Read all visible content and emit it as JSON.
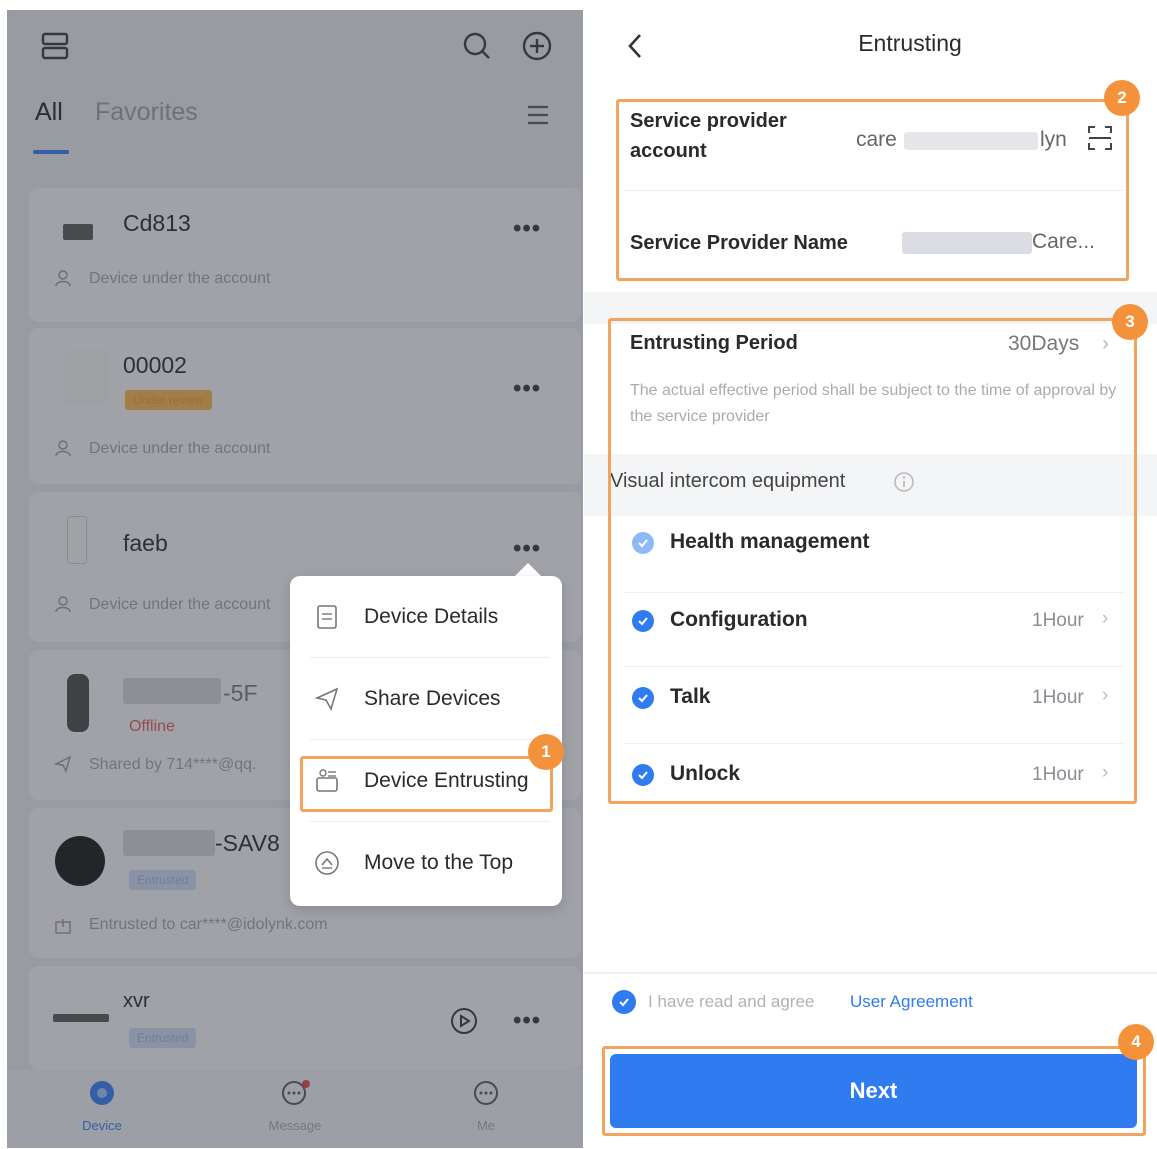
{
  "left": {
    "tabs": {
      "all": "All",
      "favorites": "Favorites"
    },
    "devices": [
      {
        "name": "Cd813",
        "sub": "Device under the account"
      },
      {
        "name": "00002",
        "tag": "Under review",
        "sub": "Device under the account"
      },
      {
        "name": "faeb",
        "sub": "Device under the account"
      },
      {
        "name": "-5F",
        "status": "Offline",
        "sub": "Shared by 714****@qq."
      },
      {
        "name": "-SAV8",
        "tag": "Entrusted",
        "sub": "Entrusted to car****@idolynk.com"
      },
      {
        "name": "xvr",
        "tag": "Entrusted"
      }
    ],
    "more_glyph": "•••",
    "bottom_tabs": [
      {
        "label": "Device",
        "active": true
      },
      {
        "label": "Message",
        "active": false
      },
      {
        "label": "Me",
        "active": false
      }
    ],
    "popup_menu": [
      {
        "label": "Device Details",
        "icon": "document-icon"
      },
      {
        "label": "Share Devices",
        "icon": "share-icon"
      },
      {
        "label": "Device Entrusting",
        "icon": "entrust-icon"
      },
      {
        "label": "Move to the Top",
        "icon": "pin-top-icon"
      }
    ]
  },
  "right": {
    "title": "Entrusting",
    "service_account_label_1": "Service provider",
    "service_account_label_2": "account",
    "service_account_value_prefix": "care",
    "service_account_value_suffix": "lyn",
    "service_name_label": "Service Provider Name",
    "service_name_value": "Care...",
    "period_label": "Entrusting Period",
    "period_value": "30Days",
    "period_note": "The actual effective period shall be subject to the time of approval by the service provider",
    "group_label": "Visual intercom equipment",
    "permissions": [
      {
        "label": "Health management",
        "value": "",
        "checked": "light"
      },
      {
        "label": "Configuration",
        "value": "1Hour",
        "checked": "full"
      },
      {
        "label": "Talk",
        "value": "1Hour",
        "checked": "full"
      },
      {
        "label": "Unlock",
        "value": "1Hour",
        "checked": "full"
      }
    ],
    "agree_text": "I have read and agree",
    "agree_link": "User Agreement",
    "next_label": "Next"
  },
  "badges": [
    "1",
    "2",
    "3",
    "4"
  ],
  "colors": {
    "accent": "#2f7bf0",
    "highlight": "#f2a35e",
    "badge": "#f4923b"
  }
}
